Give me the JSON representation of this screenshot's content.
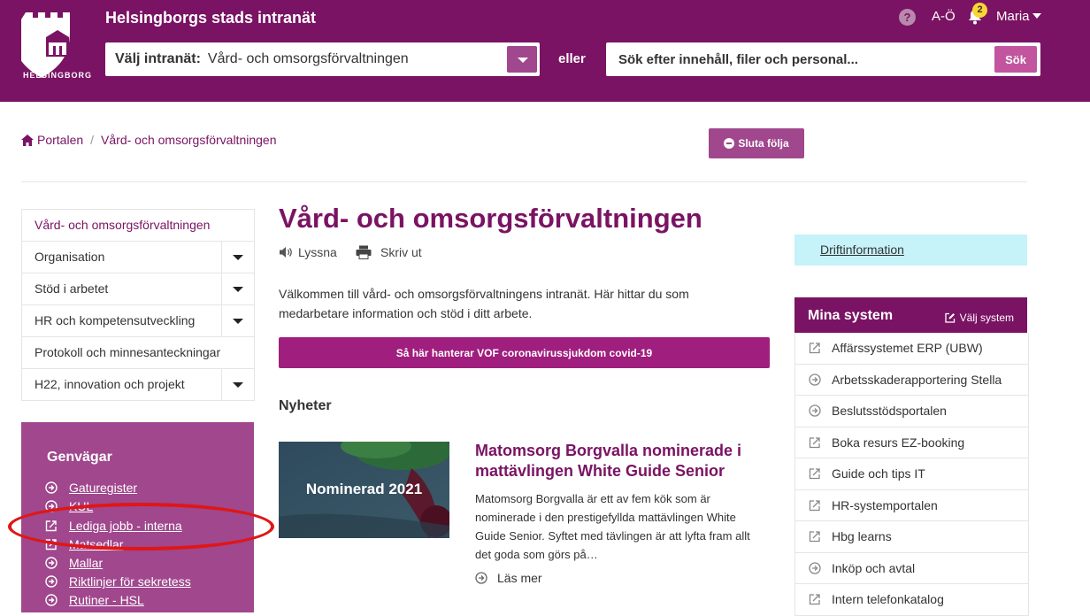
{
  "header": {
    "logo_text": "HELSINGBORG",
    "site_title": "Helsingborgs stads intranät",
    "select_label": "Välj intranät:",
    "select_value": "Vård- och omsorgsförvaltningen",
    "or_text": "eller",
    "search_placeholder": "Sök efter innehåll, filer och personal...",
    "search_button": "Sök",
    "help": "?",
    "az_link": "A-Ö",
    "notification_count": "2",
    "user_name": "Maria"
  },
  "breadcrumb": {
    "home": "Portalen",
    "current": "Vård- och omsorgsförvaltningen"
  },
  "follow_button": "Sluta följa",
  "sidebar": {
    "items": [
      {
        "label": "Vård- och omsorgsförvaltningen",
        "has_children": false
      },
      {
        "label": "Organisation",
        "has_children": true
      },
      {
        "label": "Stöd i arbetet",
        "has_children": true
      },
      {
        "label": "HR och kompetensutveckling",
        "has_children": true
      },
      {
        "label": "Protokoll och minnesanteckningar",
        "has_children": false
      },
      {
        "label": "H22, innovation och projekt",
        "has_children": true
      }
    ]
  },
  "shortcuts": {
    "title": "Genvägar",
    "items": [
      {
        "label": "Gaturegister",
        "icon": "arrow-circle-icon"
      },
      {
        "label": "KUL",
        "icon": "arrow-circle-icon"
      },
      {
        "label": "Lediga jobb - interna",
        "icon": "external-link-icon"
      },
      {
        "label": "Matsedlar",
        "icon": "external-link-icon"
      },
      {
        "label": "Mallar",
        "icon": "arrow-circle-icon"
      },
      {
        "label": "Riktlinjer för sekretess",
        "icon": "arrow-circle-icon"
      },
      {
        "label": "Rutiner - HSL",
        "icon": "arrow-circle-icon"
      }
    ]
  },
  "main": {
    "title": "Vård- och omsorgsförvaltningen",
    "listen": "Lyssna",
    "print": "Skriv ut",
    "intro": "Välkommen till vård- och omsorgsförvaltningens intranät. Här hittar du som medarbetare information och stöd i ditt arbete.",
    "covid_button": "Så här hanterar VOF coronavirussjukdom covid-19",
    "news_heading": "Nyheter",
    "news": {
      "image_label": "Nominerad 2021",
      "title": "Matomsorg Borgvalla nominerade i mattävlingen White Guide Senior",
      "body": "Matomsorg Borgvalla är ett av fem kök som är nominerade i den prestigefyllda mattävlingen White Guide Senior. Syftet med tävlingen är att lyfta fram allt det goda som görs på…",
      "read_more": "Läs mer"
    }
  },
  "right": {
    "drift_link": "Driftinformation",
    "systems_title": "Mina system",
    "choose_systems": "Välj system",
    "systems": [
      {
        "label": "Affärssystemet ERP (UBW)",
        "icon": "external-link-icon"
      },
      {
        "label": "Arbetsskaderapportering Stella",
        "icon": "arrow-circle-icon"
      },
      {
        "label": "Beslutsstödsportalen",
        "icon": "arrow-circle-icon"
      },
      {
        "label": "Boka resurs EZ-booking",
        "icon": "external-link-icon"
      },
      {
        "label": "Guide och tips IT",
        "icon": "external-link-icon"
      },
      {
        "label": "HR-systemportalen",
        "icon": "external-link-icon"
      },
      {
        "label": "Hbg learns",
        "icon": "external-link-icon"
      },
      {
        "label": "Inköp och avtal",
        "icon": "arrow-circle-icon"
      },
      {
        "label": "Intern telefonkatalog",
        "icon": "external-link-icon"
      }
    ]
  },
  "colors": {
    "brand": "#7a1363",
    "accent": "#a0478d",
    "alert_bg": "#c6f2f9",
    "annotation": "#e01616"
  }
}
